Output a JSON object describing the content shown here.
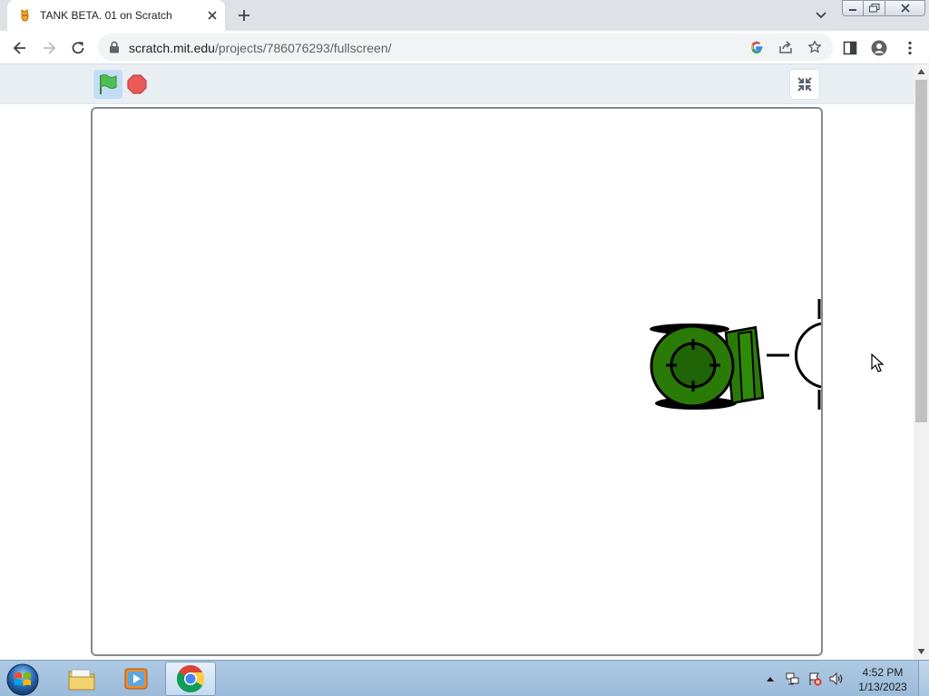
{
  "browser": {
    "tab": {
      "title": "TANK BETA. 01 on Scratch",
      "favicon": "scratch-cat-icon",
      "close_icon": "close-icon"
    },
    "new_tab_icon": "plus-icon",
    "tab_search_icon": "chevron-down-icon",
    "window_controls": [
      "minimize-icon",
      "restore-icon",
      "close-icon"
    ],
    "address_bar": {
      "host": "scratch.mit.edu",
      "path": "/projects/786076293/fullscreen/",
      "icons": [
        "google-icon",
        "share-icon",
        "bookmark-star-icon"
      ]
    },
    "toolbar_icons": [
      "back-arrow-icon",
      "forward-arrow-icon",
      "reload-icon",
      "side-panel-icon",
      "profile-icon",
      "more-vert-icon"
    ]
  },
  "scratch_player": {
    "controls": {
      "green_flag_icon": "green-flag-icon",
      "stop_icon": "stop-sign-icon",
      "unfullscreen_icon": "unfullscreen-icon"
    },
    "stage": {
      "sprites": [
        "tank-sprite",
        "target-sprite"
      ],
      "colors": {
        "tank_body": "#2a7a08",
        "tank_shadow": "#000000",
        "stage_bg": "#ffffff"
      }
    }
  },
  "taskbar": {
    "start_icon": "windows-start-icon",
    "pinned": [
      "file-explorer-icon",
      "media-player-icon",
      "chrome-icon"
    ],
    "active_app": "chrome-icon",
    "tray_icons": [
      "show-hidden-icons-icon",
      "network-icon",
      "action-center-flag-icon",
      "volume-icon"
    ],
    "clock": {
      "time": "4:52 PM",
      "date": "1/13/2023"
    }
  },
  "colors": {
    "accent_flag": "#4cbf56",
    "stop_red": "#ec5959",
    "player_bar": "#e9eef2"
  }
}
